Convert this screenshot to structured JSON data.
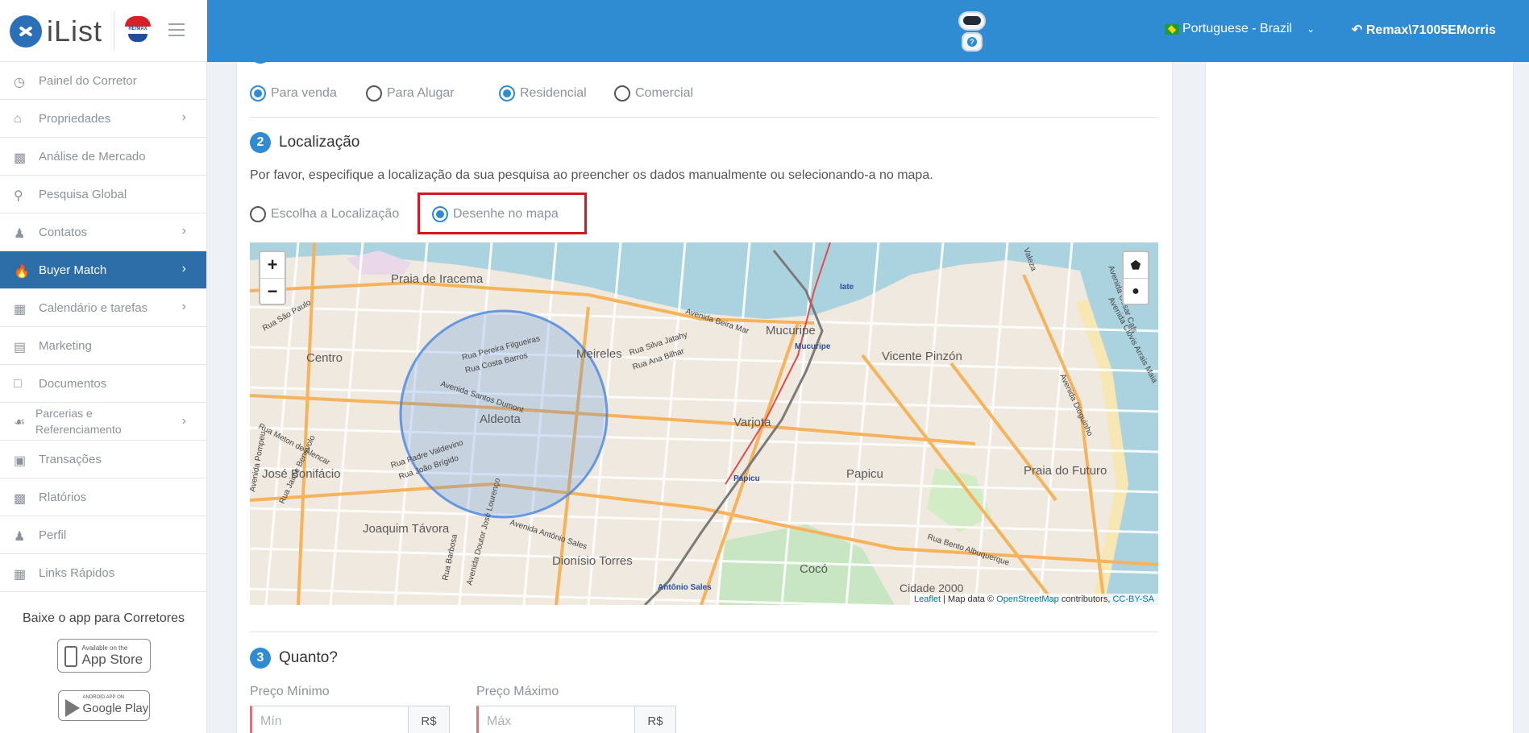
{
  "header": {
    "logo_text": "iList",
    "remax_text": "RE/MAX",
    "language": "Portuguese - Brazil",
    "user": "Remax\\71005EMorris"
  },
  "sidebar": {
    "items": [
      {
        "label": "Painel do Corretor",
        "icon": "dashboard-icon",
        "arrow": false
      },
      {
        "label": "Propriedades",
        "icon": "home-icon",
        "arrow": true
      },
      {
        "label": "Análise de Mercado",
        "icon": "bar-chart-icon",
        "arrow": false
      },
      {
        "label": "Pesquisa Global",
        "icon": "search-icon",
        "arrow": false
      },
      {
        "label": "Contatos",
        "icon": "contacts-icon",
        "arrow": true
      },
      {
        "label": "Buyer Match",
        "icon": "flame-icon",
        "arrow": true,
        "active": true
      },
      {
        "label": "Calendário e tarefas",
        "icon": "calendar-icon",
        "arrow": true
      },
      {
        "label": "Marketing",
        "icon": "book-icon",
        "arrow": false
      },
      {
        "label": "Documentos",
        "icon": "folder-icon",
        "arrow": false
      },
      {
        "label": "Parcerias e Referenciamento",
        "icon": "handshake-icon",
        "arrow": true
      },
      {
        "label": "Transações",
        "icon": "briefcase-icon",
        "arrow": false
      },
      {
        "label": "Rlatórios",
        "icon": "bar-chart-icon",
        "arrow": false
      },
      {
        "label": "Perfil",
        "icon": "user-icon",
        "arrow": false
      },
      {
        "label": "Links Rápidos",
        "icon": "building-icon",
        "arrow": false
      }
    ],
    "promo_label": "Baixe o app para Corretores",
    "appstore_small": "Available on the",
    "appstore_big": "App Store",
    "googleplay_small": "ANDROID APP ON",
    "googleplay_big": "Google Play"
  },
  "filters": {
    "options": [
      {
        "label": "Para venda",
        "checked": true
      },
      {
        "label": "Para Alugar",
        "checked": false
      },
      {
        "label": "Residencial",
        "checked": true
      },
      {
        "label": "Comercial",
        "checked": false
      }
    ]
  },
  "location": {
    "step_number": "2",
    "title": "Localização",
    "description": "Por favor, especifique a localização da sua pesquisa ao preencher os dados manualmente ou selecionando-a no mapa.",
    "mode_options": [
      {
        "label": "Escolha a Localização",
        "checked": false
      },
      {
        "label": "Desenhe no mapa",
        "checked": true
      }
    ]
  },
  "map": {
    "zoom_in": "+",
    "zoom_out": "−",
    "attribution_leaflet": "Leaflet",
    "attribution_mid": " | Map data © ",
    "attribution_osm": "OpenStreetMap",
    "attribution_contrib": " contributors, ",
    "attribution_license": "CC-BY-SA",
    "labels": [
      "Praia de Iracema",
      "Centro",
      "Meireles",
      "Mucuripe",
      "Vicente Pinzón",
      "Aldeota",
      "Varjota",
      "Papicu",
      "Praia do Futuro",
      "José Bonifácio",
      "Joaquim Távora",
      "Dionísio Torres",
      "Cocó",
      "Cidade 2000",
      "Iate",
      "Mucuripe",
      "Papicu",
      "Antônio Sales",
      "Avenida Beira Mar",
      "Rua São Paulo",
      "Rua Meton de Alencar",
      "Rua Pereira Filgueiras",
      "Rua Costa Barros",
      "Avenida Santos Dumont",
      "Rua Silva Jatahy",
      "Rua Ana Bilhar",
      "Rua Padre Valdevino",
      "Rua João Brígido",
      "Avenida Antônio Sales",
      "Rua Bento Albuquerque",
      "Avenida César Cals",
      "Avenida Clóvis Arrais Maia",
      "Avenida Dioguinho",
      "Avenida Pompeu",
      "Rua Barbosa",
      "Avenida Doutor José Lourenço",
      "Rua Jaime Benévolo",
      "Valeza"
    ]
  },
  "price": {
    "step_number": "3",
    "title": "Quanto?",
    "min_label": "Preço Mínimo",
    "min_placeholder": "Mín",
    "max_label": "Preço Máximo",
    "max_placeholder": "Máx",
    "currency": "R$"
  },
  "colors": {
    "header_blue": "#2f8bd2",
    "active_sidebar": "#2d6ea8",
    "highlight_red": "#d9141c",
    "circle_blue": "#3d7fe0"
  }
}
